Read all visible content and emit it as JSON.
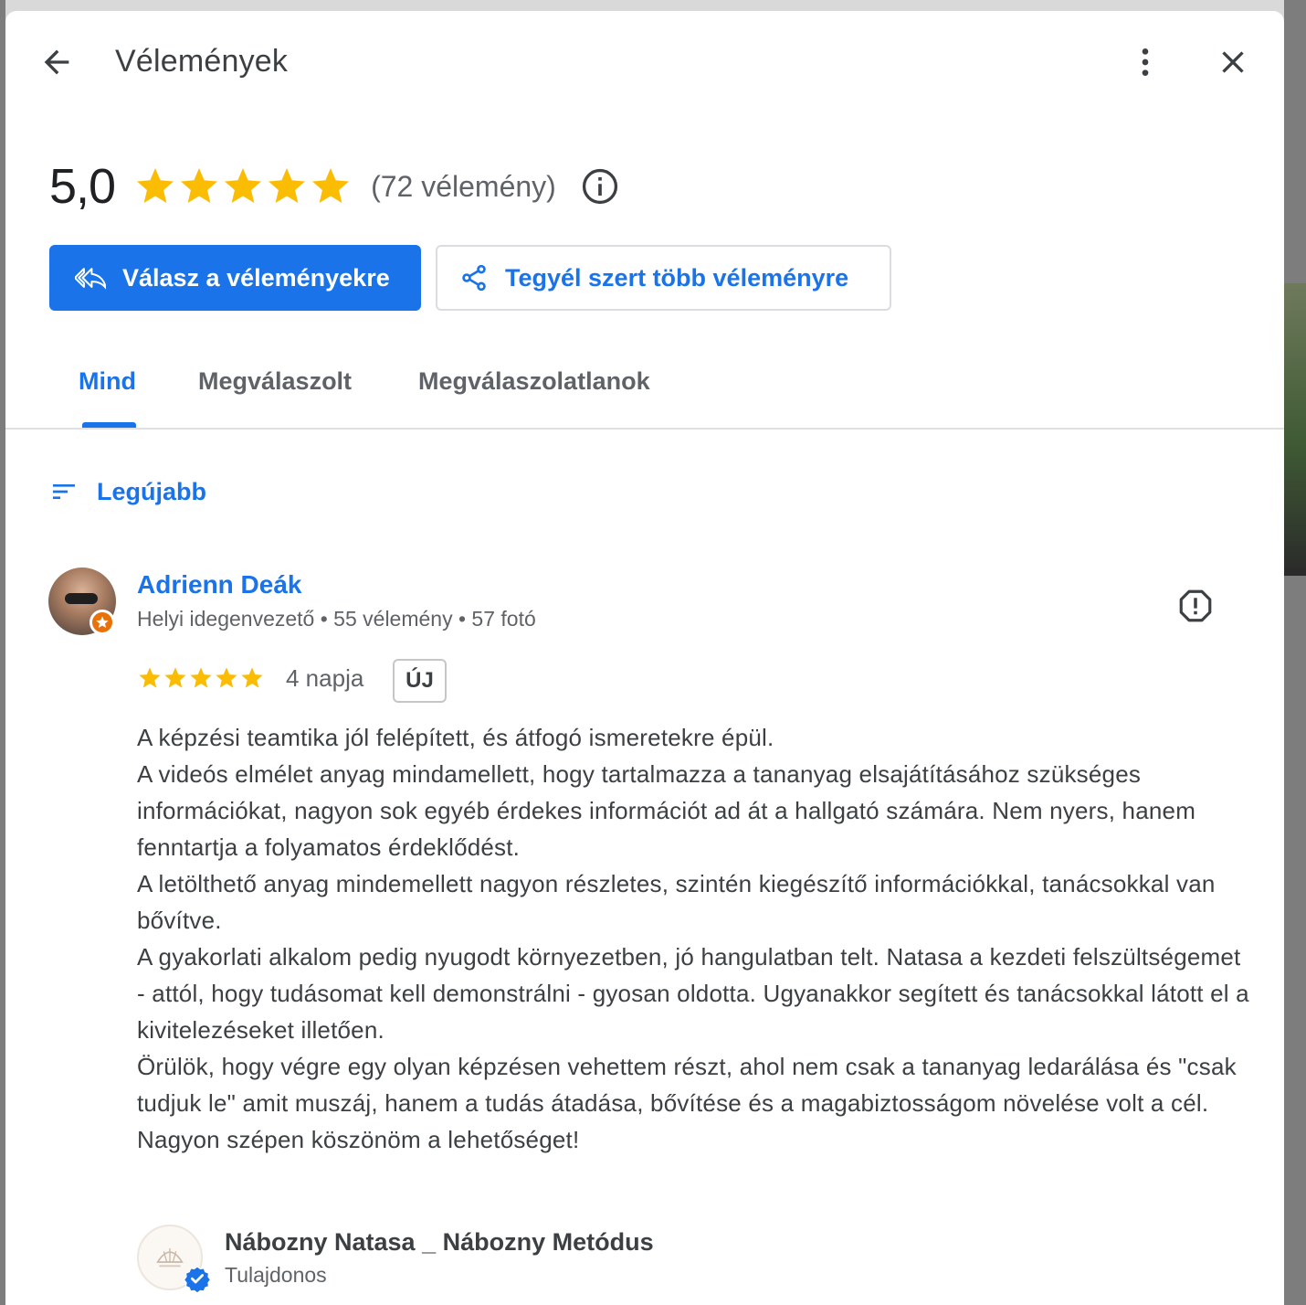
{
  "header": {
    "title": "Vélemények"
  },
  "summary": {
    "rating": "5,0",
    "stars": 5,
    "count_text": "(72 vélemény)"
  },
  "actions": {
    "reply_label": "Válasz a véleményekre",
    "share_label": "Tegyél szert több véleményre"
  },
  "tabs": [
    {
      "label": "Mind",
      "active": true
    },
    {
      "label": "Megválaszolt",
      "active": false
    },
    {
      "label": "Megválaszolatlanok",
      "active": false
    }
  ],
  "sort": {
    "label": "Legújabb"
  },
  "review": {
    "name": "Adrienn Deák",
    "meta": "Helyi idegenvezető • 55 vélemény • 57 fotó",
    "stars": 5,
    "age": "4 napja",
    "badge": "ÚJ",
    "paragraphs": [
      "A képzési teamtika jól felépített, és átfogó ismeretekre épül.",
      "A videós elmélet anyag mindamellett, hogy tartalmazza a tananyag elsajátításához szükséges információkat, nagyon sok egyéb érdekes információt ad át a hallgató számára. Nem nyers, hanem fenntartja a folyamatos érdeklődést.",
      "A letölthető anyag mindemellett nagyon részletes, szintén kiegészítő információkkal, tanácsokkal van bővítve.",
      "A gyakorlati alkalom pedig nyugodt környezetben, jó hangulatban telt. Natasa a kezdeti felszültségemet - attól, hogy tudásomat kell demonstrálni - gyosan oldotta. Ugyanakkor segített és tanácsokkal látott el a kivitelezéseket illetően.",
      "Örülök, hogy végre egy olyan képzésen vehettem részt, ahol nem csak a tananyag ledarálása és \"csak tudjuk le\" amit muszáj, hanem a tudás átadása, bővítése és a magabiztosságom növelése volt a cél.",
      "Nagyon szépen köszönöm a lehetőséget!"
    ]
  },
  "owner": {
    "name": "Nábozny Natasa _ Nábozny Metódus",
    "role": "Tulajdonos"
  },
  "colors": {
    "accent": "#1a73e8",
    "star": "#fbbc04",
    "badge_orange": "#e8710a"
  }
}
